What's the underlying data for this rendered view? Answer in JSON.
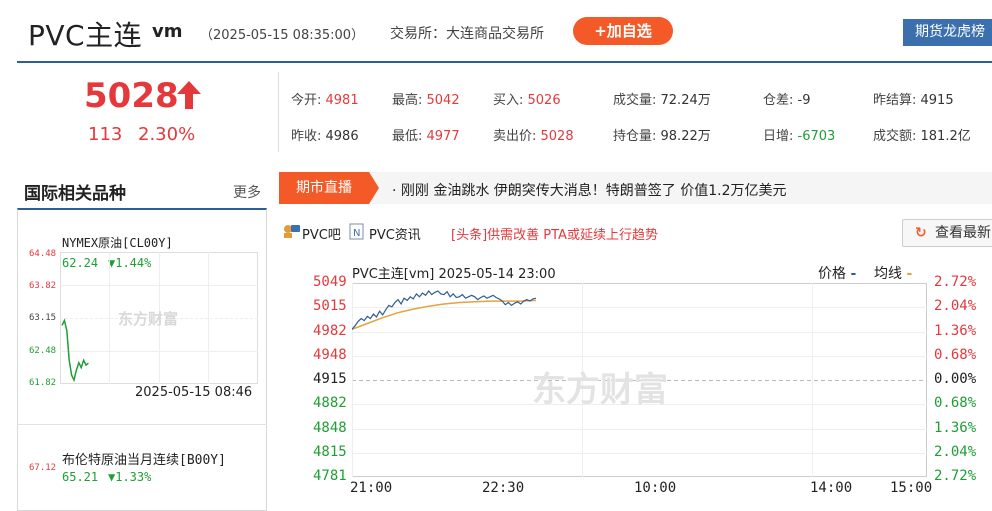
{
  "header": {
    "title": "PVC主连",
    "code": "vm",
    "timestamp": "（2025-05-15 08:35:00）",
    "exchange": "交易所：大连商品交易所",
    "add_watch_label": "+加自选",
    "rank_label": "期货龙虎榜"
  },
  "quote": {
    "price": "5028",
    "change": "113",
    "change_pct": "2.30%",
    "fields": [
      {
        "label": "今开:",
        "value": "4981",
        "tone": "red"
      },
      {
        "label": "最高:",
        "value": "5042",
        "tone": "red"
      },
      {
        "label": "买入:",
        "value": "5026",
        "tone": "red"
      },
      {
        "label": "成交量:",
        "value": "72.24万",
        "tone": "plain"
      },
      {
        "label": "仓差:",
        "value": "-9",
        "tone": "plain"
      },
      {
        "label": "昨结算:",
        "value": "4915",
        "tone": "plain"
      },
      {
        "label": "昨收:",
        "value": "4986",
        "tone": "plain"
      },
      {
        "label": "最低:",
        "value": "4977",
        "tone": "red"
      },
      {
        "label": "卖出价:",
        "value": "5028",
        "tone": "red"
      },
      {
        "label": "持仓量:",
        "value": "98.22万",
        "tone": "plain"
      },
      {
        "label": "日增:",
        "value": "-6703",
        "tone": "green"
      },
      {
        "label": "成交额:",
        "value": "181.2亿",
        "tone": "plain"
      }
    ]
  },
  "live": {
    "tag": "期市直播",
    "news": "· 刚刚 金油跳水 伊朗突传大消息！特朗普签了 价值1.2万亿美元"
  },
  "intl": {
    "heading": "国际相关品种",
    "more": "更多",
    "items": [
      {
        "name": "NYMEX原油[CL00Y]",
        "value": "62.24",
        "change": "▼1.44%",
        "yticks": [
          "64.48",
          "63.82",
          "63.15",
          "62.48",
          "61.82"
        ],
        "time": "2025-05-15 08:46",
        "watermark": "东方财富"
      },
      {
        "name": "布伦特原油当月连续[B00Y]",
        "value": "65.21",
        "change": "▼1.33%",
        "yticks": [
          "67.12"
        ]
      }
    ]
  },
  "links": {
    "bar": "PVC吧",
    "news": "PVC资讯",
    "headline": "[头条]供需改善 PTA或延续上行趋势",
    "latest_label": "查看最新"
  },
  "chart_data": {
    "type": "line",
    "title": "PVC主连[vm] 2025-05-14 23:00",
    "legend": [
      {
        "name": "价格",
        "color": "#2f5d96"
      },
      {
        "name": "均线",
        "color": "#e6a23c"
      }
    ],
    "watermark": "东方财富",
    "y_left_ticks": [
      "5049",
      "5015",
      "4982",
      "4948",
      "4915",
      "4882",
      "4848",
      "4815",
      "4781"
    ],
    "y_right_ticks": [
      "2.72%",
      "2.04%",
      "1.36%",
      "0.68%",
      "0.00%",
      "0.68%",
      "1.36%",
      "2.04%",
      "2.72%"
    ],
    "x_ticks": [
      "21:00",
      "22:30",
      "10:00",
      "14:00",
      "15:00"
    ],
    "ylim": [
      4781,
      5049
    ],
    "prev_settle": 4915,
    "x_sessions_total_min": 375,
    "series": [
      {
        "name": "价格",
        "x": [
          0,
          2,
          4,
          6,
          8,
          10,
          12,
          14,
          16,
          18,
          20,
          22,
          24,
          26,
          28,
          30,
          32,
          34,
          36,
          38,
          40,
          42,
          44,
          46,
          48,
          50,
          52,
          54,
          56,
          58,
          60,
          62,
          64,
          66,
          68,
          70,
          72,
          74,
          76,
          78,
          80,
          82,
          84,
          86,
          88,
          90,
          92,
          94,
          96,
          98,
          100,
          102,
          104,
          106,
          108,
          110,
          112,
          114,
          116,
          118,
          120
        ],
        "values": [
          4985,
          4990,
          4996,
          5000,
          4997,
          5003,
          5000,
          5006,
          5002,
          5010,
          5005,
          5012,
          5018,
          5016,
          5022,
          5026,
          5020,
          5028,
          5025,
          5030,
          5027,
          5034,
          5030,
          5035,
          5032,
          5038,
          5033,
          5036,
          5038,
          5034,
          5033,
          5037,
          5030,
          5034,
          5029,
          5030,
          5033,
          5028,
          5030,
          5032,
          5030,
          5026,
          5029,
          5031,
          5028,
          5030,
          5032,
          5029,
          5027,
          5024,
          5019,
          5022,
          5018,
          5021,
          5023,
          5020,
          5024,
          5026,
          5024,
          5027,
          5028
        ]
      },
      {
        "name": "均线",
        "x": [
          0,
          10,
          20,
          30,
          40,
          50,
          60,
          70,
          80,
          90,
          100,
          110,
          120
        ],
        "values": [
          4985,
          4993,
          5001,
          5008,
          5013,
          5017,
          5020,
          5022,
          5023,
          5024,
          5024,
          5024,
          5025
        ]
      }
    ]
  },
  "mini_chart": {
    "ylim": [
      61.82,
      64.48
    ],
    "values": [
      63.0,
      63.1,
      62.9,
      62.3,
      62.0,
      61.9,
      62.1,
      62.25,
      62.15,
      62.3,
      62.2,
      62.24
    ]
  }
}
